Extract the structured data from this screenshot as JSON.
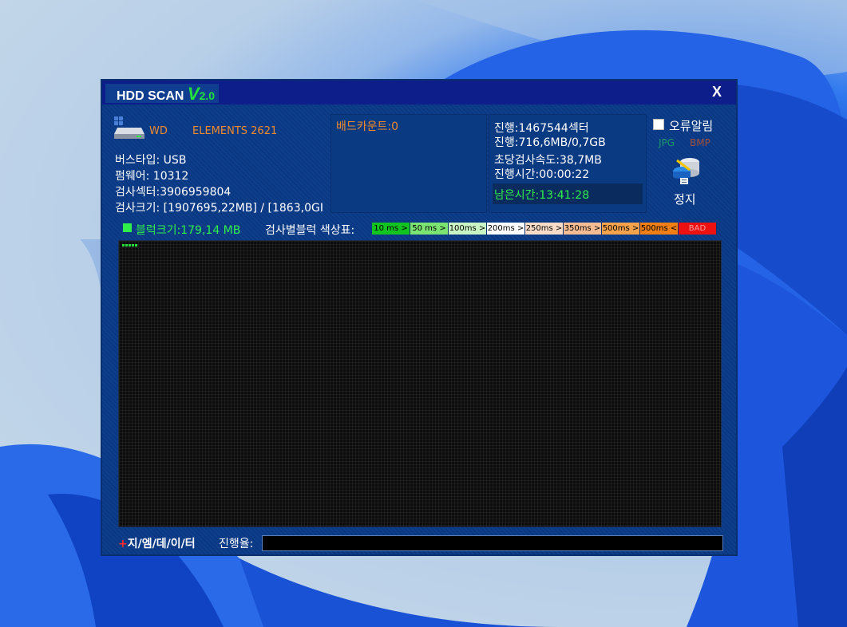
{
  "title": {
    "name": "HDD SCAN",
    "version_v": "V",
    "version_num": "2.0"
  },
  "close_label": "X",
  "drive": {
    "vendor": "WD",
    "model": "ELEMENTS 2621"
  },
  "info": {
    "bus_type": "버스타입: USB",
    "firmware": "펌웨어: 10312",
    "sectors": "검사섹터:3906959804",
    "size": "검사크기: [1907695,22MB] / [1863,0GI"
  },
  "bad_count": "배드카운트:0",
  "progress": {
    "sectors": "진행:1467544섹터",
    "data": "진행:716,6MB/0,7GB",
    "speed": "초당검사속도:38,7MB",
    "elapsed": "진행시간:00:00:22",
    "remaining": "남은시간:13:41:28"
  },
  "error_alarm": "오류알림",
  "export": {
    "jpg": "JPG",
    "bmp": "BMP"
  },
  "stop_label": "정지",
  "block_size": "블럭크기:179,14 MB",
  "legend_title": "검사별블럭 색상표:",
  "legend": [
    {
      "label": "10 ms >",
      "color": "#12c41f"
    },
    {
      "label": "50 ms >",
      "color": "#7ae372"
    },
    {
      "label": "100ms >",
      "color": "#c9f5c4"
    },
    {
      "label": "200ms >",
      "color": "#ffffff"
    },
    {
      "label": "250ms >",
      "color": "#f8dcc8"
    },
    {
      "label": "350ms >",
      "color": "#f5bb92"
    },
    {
      "label": "500ms >",
      "color": "#f4a24c"
    },
    {
      "label": "500ms <",
      "color": "#f07e12"
    },
    {
      "label": "BAD",
      "color": "#ee1111"
    }
  ],
  "colors": {
    "accent_green": "#2ff04a",
    "accent_orange": "#f08a2a",
    "bad_red": "#ee1111"
  },
  "footer": {
    "brand_plus": "+",
    "brand": "지/엠/데/이/터",
    "progress_label": "진행율:"
  },
  "scan_progress_blocks": 5
}
